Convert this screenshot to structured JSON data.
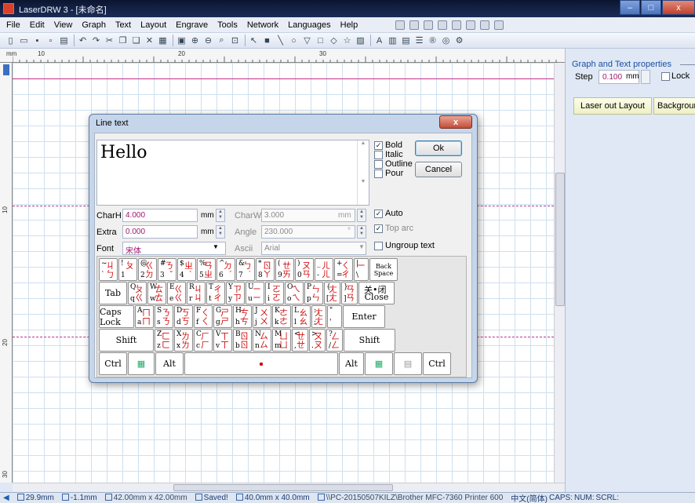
{
  "window": {
    "title": "LaserDRW 3 - [未命名]",
    "min": "–",
    "max": "□",
    "close": "x"
  },
  "menu": [
    "File",
    "Edit",
    "View",
    "Graph",
    "Text",
    "Layout",
    "Engrave",
    "Tools",
    "Network",
    "Languages",
    "Help"
  ],
  "ruler": {
    "h_labels": [
      "10",
      "20",
      "30"
    ],
    "v_labels": [
      "10",
      "20",
      "30"
    ]
  },
  "right_panel": {
    "title": "Graph and Text properties",
    "step_label": "Step",
    "step_value": "0.100",
    "step_unit": "mm",
    "lock_label": "Lock",
    "laser_out_layout": "Laser out Layout",
    "background": "Backgroun"
  },
  "dialog": {
    "title": "Line text",
    "close": "x",
    "text": "Hello",
    "bold": "Bold",
    "italic": "Italic",
    "outline": "Outline",
    "pour": "Pour",
    "ok": "Ok",
    "cancel": "Cancel",
    "charh_label": "CharH",
    "charh_value": "4.000",
    "charh_unit": "mm",
    "charw_label": "CharW",
    "charw_value": "3.000",
    "charw_unit": "mm",
    "extra_label": "Extra",
    "extra_value": "0.000",
    "extra_unit": "mm",
    "angle_label": "Angle",
    "angle_value": "230.000",
    "angle_unit": "°",
    "font_label": "Font",
    "font_value": "宋体",
    "ascii_label": "Ascii",
    "ascii_value": "Arial",
    "auto": "Auto",
    "top_arc": "Top arc",
    "ungroup": "Ungroup text"
  },
  "keyboard": {
    "row1": [
      [
        "~",
        "`",
        "ㄐ",
        "ㄅ"
      ],
      [
        "!",
        "1",
        "ㄆ",
        ""
      ],
      [
        "@",
        "2",
        "ㄍ",
        "ㄉ"
      ],
      [
        "#",
        "3",
        "ㄋ",
        "ˇ"
      ],
      [
        "$",
        "4",
        "ㄓ",
        "ˋ"
      ],
      [
        "%",
        "5",
        "ㄢ",
        "ㄓ"
      ],
      [
        "^",
        "6",
        "ㄉ",
        "ˊ"
      ],
      [
        "&",
        "7",
        "ㄅ",
        "˙"
      ],
      [
        "*",
        "8",
        "ㄖ",
        "ㄚ"
      ],
      [
        "(",
        "9",
        "ㄝ",
        "ㄞ"
      ],
      [
        ")",
        "0",
        "ㄡ",
        "ㄢ"
      ],
      [
        "_",
        "-",
        "ㄦ",
        "ㄦ"
      ],
      [
        "+",
        "=",
        "ㄑ",
        "ㄔ"
      ],
      [
        "|",
        "\\",
        "ㄧ",
        ""
      ]
    ],
    "backspace": "Back Space",
    "tab": "Tab",
    "row2": [
      [
        "Q",
        "q",
        "ㄆ",
        "ㄍ"
      ],
      [
        "W",
        "w",
        "ㄊ",
        "ㄊ"
      ],
      [
        "E",
        "e",
        "ㄍ",
        "ㄍ"
      ],
      [
        "R",
        "r",
        "ㄐ",
        "ㄐ"
      ],
      [
        "T",
        "t",
        "ㄔ",
        "ㄔ"
      ],
      [
        "Y",
        "y",
        "ㄗ",
        "ㄗ"
      ],
      [
        "U",
        "u",
        "ㄧ",
        "ㄧ"
      ],
      [
        "I",
        "i",
        "ㄛ",
        "ㄛ"
      ],
      [
        "O",
        "o",
        "ㄟ",
        "ㄟ"
      ],
      [
        "P",
        "p",
        "ㄣ",
        "ㄣ"
      ],
      [
        "{",
        "[",
        "ㄤ",
        "ㄤ"
      ],
      [
        "}",
        "]",
        "ㄢ",
        "ㄢ"
      ]
    ],
    "close_key": "关•闭",
    "close_label": "Close",
    "caps": "Caps Lock",
    "row3": [
      [
        "A",
        "a",
        "ㄇ",
        "ㄇ"
      ],
      [
        "S",
        "s",
        "ㄋ",
        "ㄋ"
      ],
      [
        "D",
        "d",
        "ㄎ",
        "ㄎ"
      ],
      [
        "F",
        "f",
        "ㄑ",
        "ㄑ"
      ],
      [
        "G",
        "g",
        "ㄕ",
        "ㄕ"
      ],
      [
        "H",
        "h",
        "ㄘ",
        "ㄘ"
      ],
      [
        "J",
        "j",
        "ㄨ",
        "ㄨ"
      ],
      [
        "K",
        "k",
        "ㄜ",
        "ㄜ"
      ],
      [
        "L",
        "l",
        "ㄠ",
        "ㄠ"
      ],
      [
        ":",
        ";",
        "ㄤ",
        "ㄤ"
      ],
      [
        "\"",
        "'",
        "",
        ""
      ]
    ],
    "enter": "Enter",
    "shift": "Shift",
    "row4": [
      [
        "Z",
        "z",
        "ㄈ",
        "ㄈ"
      ],
      [
        "X",
        "x",
        "ㄌ",
        "ㄌ"
      ],
      [
        "C",
        "c",
        "ㄏ",
        "ㄏ"
      ],
      [
        "V",
        "v",
        "ㄒ",
        "ㄒ"
      ],
      [
        "B",
        "b",
        "ㄖ",
        "ㄖ"
      ],
      [
        "N",
        "n",
        "ㄙ",
        "ㄙ"
      ],
      [
        "M",
        "m",
        "ㄩ",
        "ㄩ"
      ],
      [
        "<",
        ",",
        "ㄝ",
        "ㄝ"
      ],
      [
        ">",
        ".",
        "ㄡ",
        "ㄡ"
      ],
      [
        "?",
        "/",
        "ㄥ",
        "ㄥ"
      ]
    ],
    "ctrl": "Ctrl",
    "alt": "Alt"
  },
  "status": {
    "x": "29.9mm",
    "y": "-1.1mm",
    "size1": "42.00mm x 42.00mm",
    "saved": "Saved!",
    "size2": "40.0mm x 40.0mm",
    "printer": "\\\\PC-20150507KILZ\\Brother MFC-7360 Printer 600",
    "ime": "中文(简体)",
    "caps": "CAPS:",
    "num": "NUM:",
    "scrl": "SCRL:"
  }
}
